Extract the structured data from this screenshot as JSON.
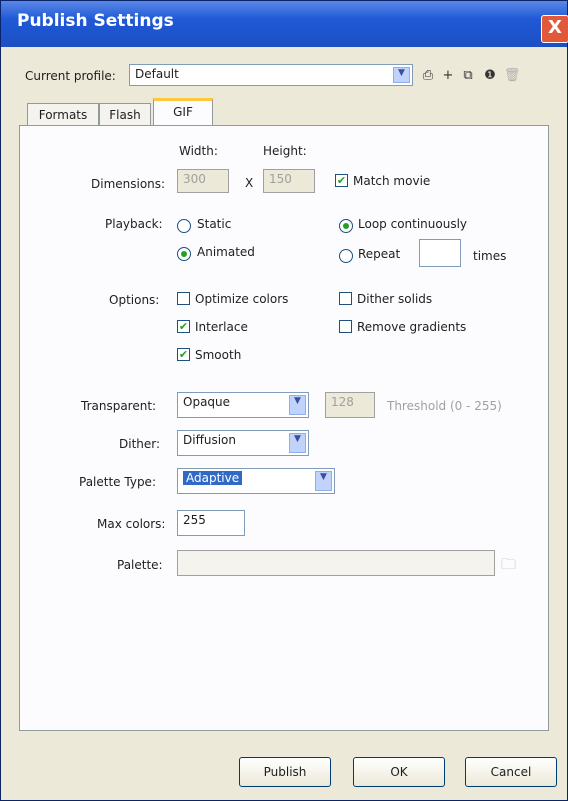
{
  "window": {
    "title": "Publish Settings",
    "close_glyph": "X"
  },
  "profile": {
    "label": "Current profile:",
    "value": "Default",
    "toolbar_icons": [
      "import-export-icon",
      "add-profile-icon",
      "duplicate-profile-icon",
      "info-icon",
      "delete-profile-icon"
    ]
  },
  "tabs": [
    {
      "label": "Formats",
      "active": false
    },
    {
      "label": "Flash",
      "active": false
    },
    {
      "label": "GIF",
      "active": true
    }
  ],
  "dimensions": {
    "label": "Dimensions:",
    "width_label": "Width:",
    "height_label": "Height:",
    "width_value": "300",
    "height_value": "150",
    "separator": "X",
    "match_movie_label": "Match movie",
    "match_movie_checked": true
  },
  "playback": {
    "label": "Playback:",
    "static_label": "Static",
    "animated_label": "Animated",
    "selected": "Animated",
    "loop_label": "Loop continuously",
    "repeat_label": "Repeat",
    "repeat_value": "",
    "times_label": "times",
    "loop_selected": "Loop continuously"
  },
  "options": {
    "label": "Options:",
    "items": [
      {
        "label": "Optimize colors",
        "checked": false
      },
      {
        "label": "Interlace",
        "checked": true
      },
      {
        "label": "Smooth",
        "checked": true
      },
      {
        "label": "Dither solids",
        "checked": false
      },
      {
        "label": "Remove gradients",
        "checked": false
      }
    ]
  },
  "transparent": {
    "label": "Transparent:",
    "value": "Opaque",
    "threshold_value": "128",
    "threshold_label": "Threshold (0 - 255)"
  },
  "dither": {
    "label": "Dither:",
    "value": "Diffusion"
  },
  "palette_type": {
    "label": "Palette Type:",
    "value": "Adaptive"
  },
  "max_colors": {
    "label": "Max colors:",
    "value": "255"
  },
  "palette": {
    "label": "Palette:",
    "value": ""
  },
  "buttons": {
    "publish": "Publish",
    "ok": "OK",
    "cancel": "Cancel"
  },
  "colors": {
    "titlebar": "#1f58d6",
    "dialog_bg": "#ece9d8",
    "check_green": "#21a121",
    "selection": "#316ac5"
  }
}
